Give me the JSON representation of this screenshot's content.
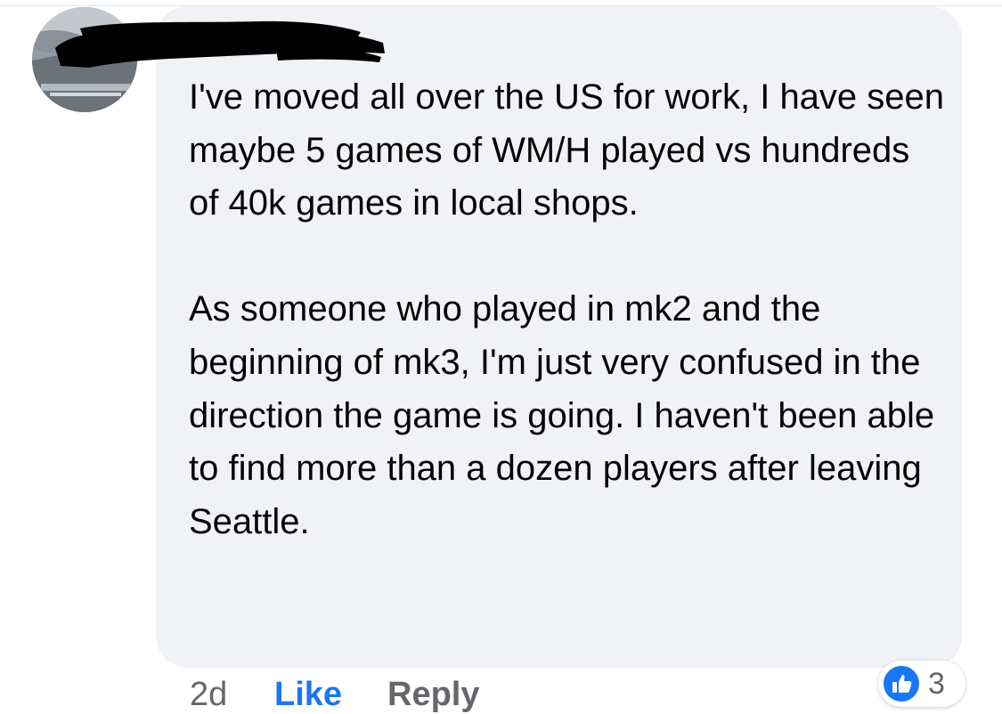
{
  "comment": {
    "author_name": "",
    "paragraphs": [
      "I've moved all over the US for work, I have seen maybe 5 games of WM/H played vs hundreds of 40k games in local shops.",
      "As someone who played in mk2 and the beginning of mk3, I'm just very confused in the direction the game is going. I haven't been able to find more than a dozen players after leaving Seattle."
    ]
  },
  "actions": {
    "timestamp": "2d",
    "like_label": "Like",
    "reply_label": "Reply"
  },
  "reactions": {
    "icon": "thumbs-up-icon",
    "count": "3"
  },
  "colors": {
    "bubble_background": "#f0f2f5",
    "link_blue": "#1877f2",
    "secondary_text": "#65676b",
    "primary_text": "#050505"
  }
}
